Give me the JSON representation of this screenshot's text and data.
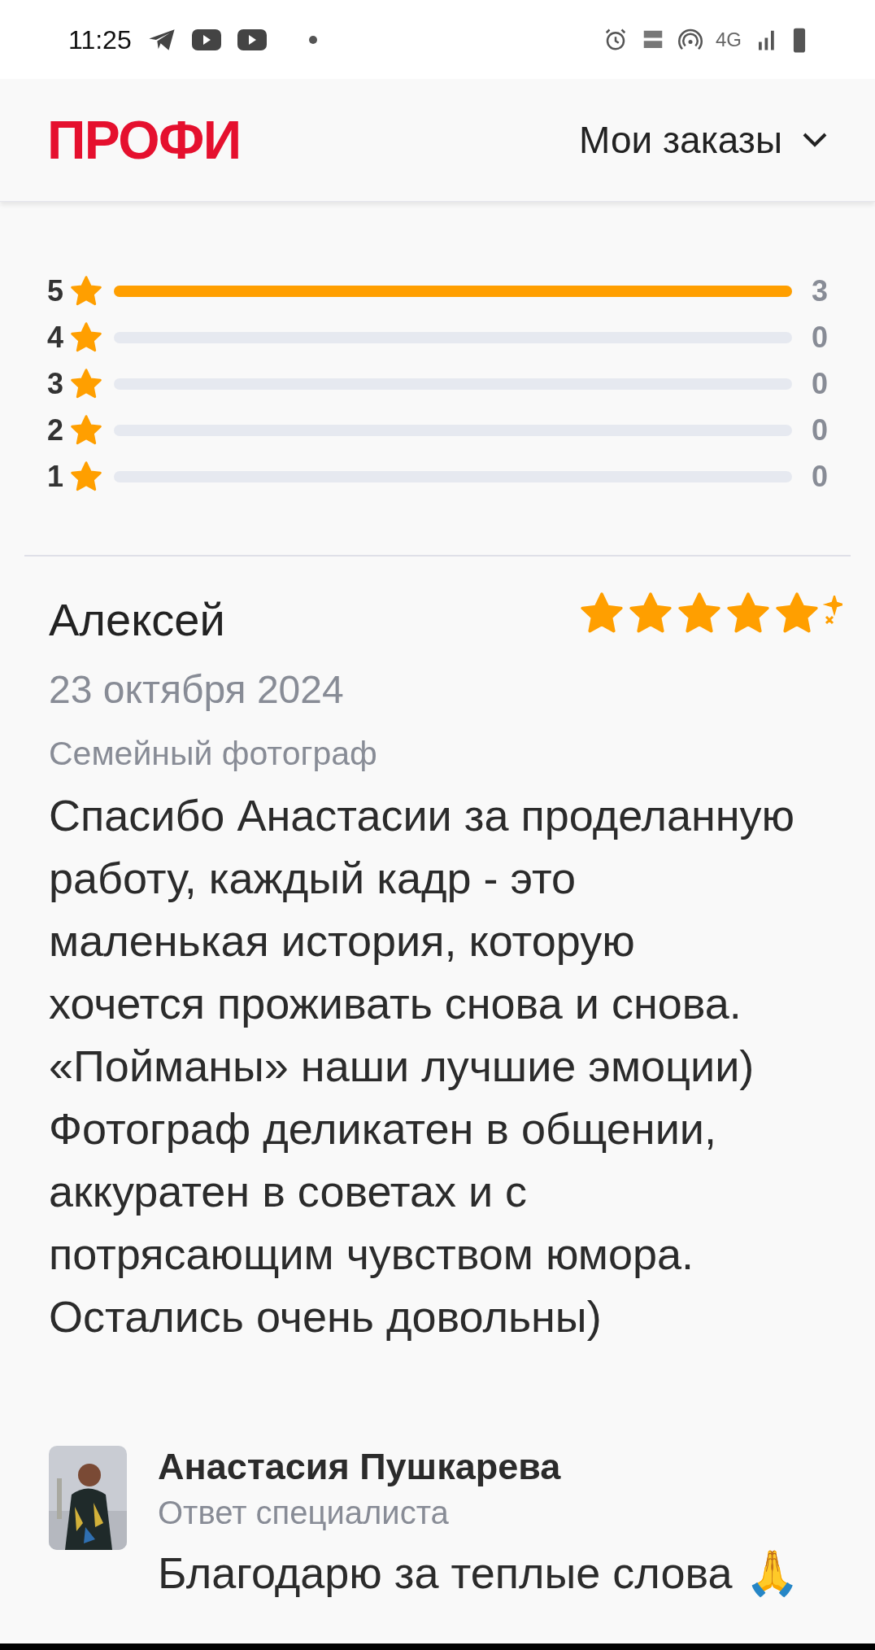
{
  "status_bar": {
    "time": "11:25",
    "network": "4G"
  },
  "header": {
    "logo": "ПРОФИ",
    "menu": {
      "label": "Мои заказы",
      "expanded": false
    }
  },
  "rating_breakdown": [
    {
      "grade": "5",
      "level": 1,
      "count": "3"
    },
    {
      "grade": "4",
      "level": 0,
      "count": "0"
    },
    {
      "grade": "3",
      "level": 0,
      "count": "0"
    },
    {
      "grade": "2",
      "level": 0,
      "count": "0"
    },
    {
      "grade": "1",
      "level": 0,
      "count": "0"
    }
  ],
  "review": {
    "author": "Алексей",
    "stars": 5,
    "date": "23 октября 2024",
    "service": "Семейный фотограф",
    "text": "Спасибо Анастасии за проделанную\nработу, каждый кадр - это\nмаленькая история, которую\nхочется проживать снова и снова.\n«Пойманы» наши лучшие эмоции)\nФотограф деликатен в общении,\nаккуратен в советах и с\nпотрясающим чувством юмора.\nОстались очень довольны)",
    "reply": {
      "author": "Анастасия Пушкарева",
      "role": "Ответ специалиста",
      "text": "Благодарю за теплые слова 🙏"
    }
  }
}
